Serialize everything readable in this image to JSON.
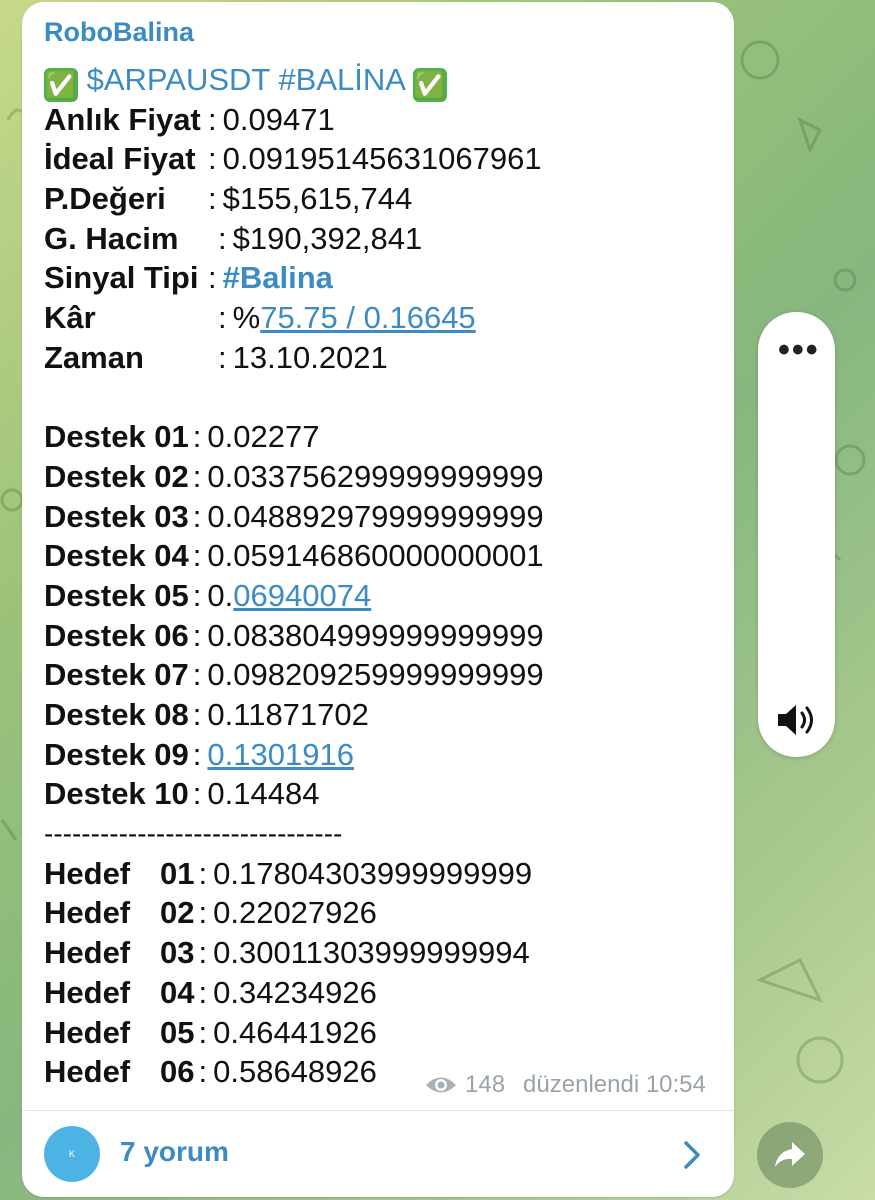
{
  "sender": "RoboBalina",
  "title": {
    "check_left": "✅",
    "text": "$ARPAUSDT #BALİNA",
    "check_right": "✅"
  },
  "info": [
    {
      "label": "Anlık Fiyat",
      "sep": ":",
      "prefix": "",
      "value": "0.09471",
      "style": "plain"
    },
    {
      "label": "İdeal Fiyat",
      "sep": ":",
      "prefix": "",
      "value": "0.09195145631067961",
      "style": "plain"
    },
    {
      "label": "P.Değeri",
      "sep": ":",
      "prefix": "",
      "value": "$155,615,744",
      "style": "plain"
    },
    {
      "label": "G. Hacim",
      "sep": ":",
      "prefix": "",
      "value": "$190,392,841",
      "style": "plain"
    },
    {
      "label": "Sinyal Tipi",
      "sep": ":",
      "prefix": "",
      "value": "#Balina",
      "style": "hash"
    },
    {
      "label": "Kâr",
      "sep": ":",
      "prefix": "%",
      "value": "75.75 / 0.16645",
      "style": "link"
    },
    {
      "label": "Zaman",
      "sep": ":",
      "prefix": "",
      "value": "13.10.2021",
      "style": "plain"
    }
  ],
  "supports": [
    {
      "label": "Destek 01",
      "prefix": "",
      "value": "0.02277",
      "style": "plain"
    },
    {
      "label": "Destek 02",
      "prefix": "",
      "value": "0.033756299999999999",
      "style": "plain"
    },
    {
      "label": "Destek 03",
      "prefix": "",
      "value": "0.048892979999999999",
      "style": "plain"
    },
    {
      "label": "Destek 04",
      "prefix": "",
      "value": "0.059146860000000001",
      "style": "plain"
    },
    {
      "label": "Destek 05",
      "prefix": "0.",
      "value": "06940074",
      "style": "link"
    },
    {
      "label": "Destek 06",
      "prefix": "",
      "value": "0.083804999999999999",
      "style": "plain"
    },
    {
      "label": "Destek 07",
      "prefix": "",
      "value": "0.098209259999999999",
      "style": "plain"
    },
    {
      "label": "Destek 08",
      "prefix": "",
      "value": "0.11871702",
      "style": "plain"
    },
    {
      "label": "Destek 09",
      "prefix": "",
      "value": "0.1301916",
      "style": "link"
    },
    {
      "label": "Destek 10",
      "prefix": "",
      "value": "0.14484",
      "style": "plain"
    }
  ],
  "separator": "--------------------------------",
  "targets": [
    {
      "label": "Hedef",
      "num": "01",
      "value": "0.17804303999999999"
    },
    {
      "label": "Hedef",
      "num": "02",
      "value": "0.22027926"
    },
    {
      "label": "Hedef",
      "num": "03",
      "value": "0.30011303999999994"
    },
    {
      "label": "Hedef",
      "num": "04",
      "value": "0.34234926"
    },
    {
      "label": "Hedef",
      "num": "05",
      "value": "0.46441926"
    },
    {
      "label": "Hedef",
      "num": "06",
      "value": "0.58648926"
    }
  ],
  "meta": {
    "views": "148",
    "edited": "düzenlendi 10:54"
  },
  "comments": {
    "avatar_text": "K",
    "label": "7 yorum"
  },
  "side_panel": {
    "menu_glyph": "•••"
  },
  "colors": {
    "accent": "#3c8bc3",
    "check": "#4bb34b",
    "avatar": "#4db2e4"
  },
  "icons": [
    "eye-icon",
    "chevron-right-icon",
    "speaker-icon",
    "share-icon",
    "more-icon",
    "check-icon"
  ]
}
